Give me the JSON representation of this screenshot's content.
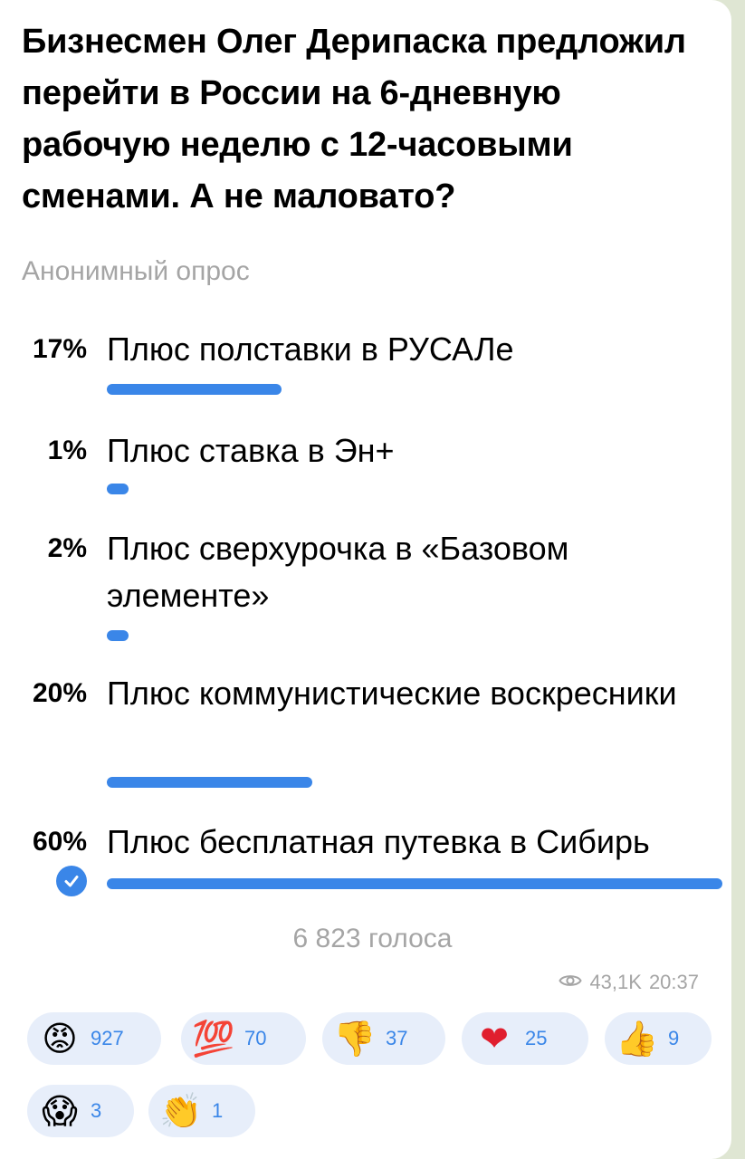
{
  "post": {
    "title": "Бизнесмен Олег Дерипаска предложил перейти в России на 6-дневную рабочую неделю с 12-часовыми сменами. А не маловато?"
  },
  "poll": {
    "type_label": "Анонимный опрос",
    "options": [
      {
        "percent": "17%",
        "label": "Плюс полставки в РУСАЛе",
        "fraction": 0.17,
        "selected": false
      },
      {
        "percent": "1%",
        "label": "Плюс ставка в Эн+",
        "fraction": 0.01,
        "selected": false
      },
      {
        "percent": "2%",
        "label": "Плюс сверхурочка в «Базовом элементе»",
        "fraction": 0.02,
        "selected": false
      },
      {
        "percent": "20%",
        "label": "Плюс коммунистические воскресники",
        "fraction": 0.2,
        "selected": false
      },
      {
        "percent": "60%",
        "label": "Плюс бесплатная путевка в Сибирь",
        "fraction": 0.6,
        "selected": true
      }
    ],
    "votes_label": "6 823 голоса"
  },
  "meta": {
    "views": "43,1K",
    "time": "20:37",
    "views_icon": "eye-icon"
  },
  "reactions": [
    {
      "icon": "angry-face-icon",
      "glyph": "😡",
      "count": "927"
    },
    {
      "icon": "hundred-points-icon",
      "glyph": "💯",
      "count": "70"
    },
    {
      "icon": "thumbs-down-icon",
      "glyph": "👎",
      "count": "37"
    },
    {
      "icon": "red-heart-icon",
      "glyph": "❤",
      "count": "25"
    },
    {
      "icon": "thumbs-up-icon",
      "glyph": "👍",
      "count": "9"
    },
    {
      "icon": "screaming-face-icon",
      "glyph": "😱",
      "count": "3"
    },
    {
      "icon": "clapping-hands-icon",
      "glyph": "👏",
      "count": "1"
    }
  ],
  "colors": {
    "accent": "#3a86e8",
    "muted_text": "#a5a5a5",
    "chip_bg": "#e7eefa"
  }
}
